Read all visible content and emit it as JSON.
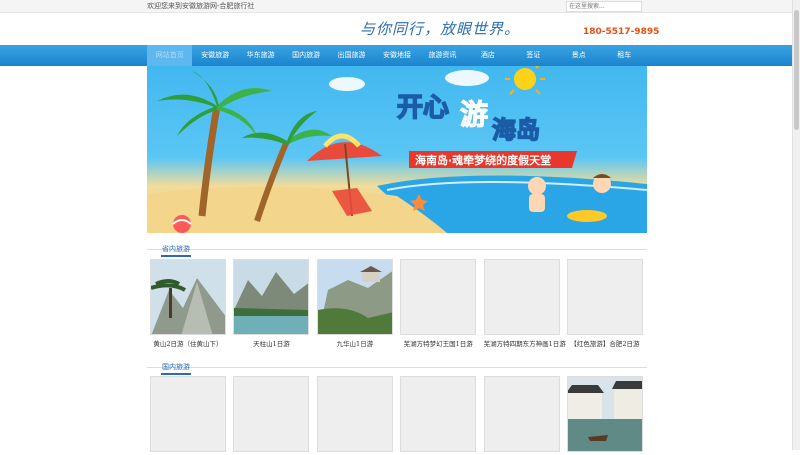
{
  "header": {
    "welcome": "欢迎您来到安徽旅游网-合肥旅行社",
    "search_placeholder": "在这里搜索...",
    "slogan": "与你同行，放眼世界。",
    "phone": "180-5517-9895"
  },
  "nav": {
    "items": [
      "网站首页",
      "安徽旅游",
      "华东旅游",
      "国内旅游",
      "出国旅游",
      "安徽地接",
      "旅游资讯",
      "酒店",
      "签证",
      "景点",
      "租车"
    ],
    "active_index": 0
  },
  "banner": {
    "line1a": "开心",
    "line1b": "游",
    "line1c": "海岛",
    "ribbon": "海南岛·魂牵梦绕的度假天堂"
  },
  "sections": [
    {
      "title": "省内旅游",
      "cards": [
        {
          "caption": "黄山2日游（住黄山下）",
          "image": "mountain-pine"
        },
        {
          "caption": "天柱山1日游",
          "image": "mountain-lake"
        },
        {
          "caption": "九华山1日游",
          "image": "temple-mountain"
        },
        {
          "caption": "芜湖方特梦幻王国1日游",
          "image": "placeholder"
        },
        {
          "caption": "芜湖方特四期东方神画1日游",
          "image": "placeholder"
        },
        {
          "caption": "【红色旅游】合肥2日游",
          "image": "placeholder"
        }
      ]
    },
    {
      "title": "国内旅游",
      "cards": [
        {
          "caption": "",
          "image": "placeholder"
        },
        {
          "caption": "",
          "image": "placeholder"
        },
        {
          "caption": "",
          "image": "placeholder"
        },
        {
          "caption": "",
          "image": "placeholder"
        },
        {
          "caption": "",
          "image": "placeholder"
        },
        {
          "caption": "",
          "image": "water-town"
        }
      ]
    }
  ],
  "colors": {
    "nav": "#1b84cc",
    "accent": "#2a6cb5",
    "phone": "#e8500e"
  }
}
